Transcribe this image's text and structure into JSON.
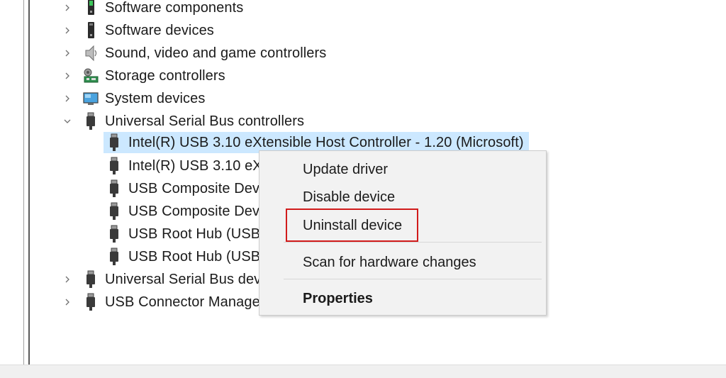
{
  "tree": {
    "categories_top": [
      {
        "label": "Software components",
        "icon": "software-components-icon",
        "expanded": false
      },
      {
        "label": "Software devices",
        "icon": "software-devices-icon",
        "expanded": false
      },
      {
        "label": "Sound, video and game controllers",
        "icon": "speaker-icon",
        "expanded": false
      },
      {
        "label": "Storage controllers",
        "icon": "storage-controller-icon",
        "expanded": false
      },
      {
        "label": "System devices",
        "icon": "system-devices-icon",
        "expanded": false
      },
      {
        "label": "Universal Serial Bus controllers",
        "icon": "usb-plug-icon",
        "expanded": true
      }
    ],
    "usb_children": [
      {
        "label": "Intel(R) USB 3.10 eXtensible Host Controller - 1.20 (Microsoft)",
        "selected": true
      },
      {
        "label": "Intel(R) USB 3.10 eXt"
      },
      {
        "label": "USB Composite Dev"
      },
      {
        "label": "USB Composite Dev"
      },
      {
        "label": "USB Root Hub (USB"
      },
      {
        "label": "USB Root Hub (USB"
      }
    ],
    "categories_bottom": [
      {
        "label": "Universal Serial Bus dev",
        "icon": "usb-plug-icon",
        "expanded": false
      },
      {
        "label": "USB Connector Manage",
        "icon": "usb-plug-icon",
        "expanded": false
      }
    ]
  },
  "context_menu": {
    "items": [
      {
        "label": "Update driver"
      },
      {
        "label": "Disable device"
      },
      {
        "label": "Uninstall device",
        "highlighted": true
      },
      {
        "label": "Scan for hardware changes"
      },
      {
        "label": "Properties",
        "bold": true
      }
    ]
  },
  "colors": {
    "selection": "#cce8ff",
    "menu_background": "#f2f2f2",
    "highlight_border": "#d11b1b"
  }
}
